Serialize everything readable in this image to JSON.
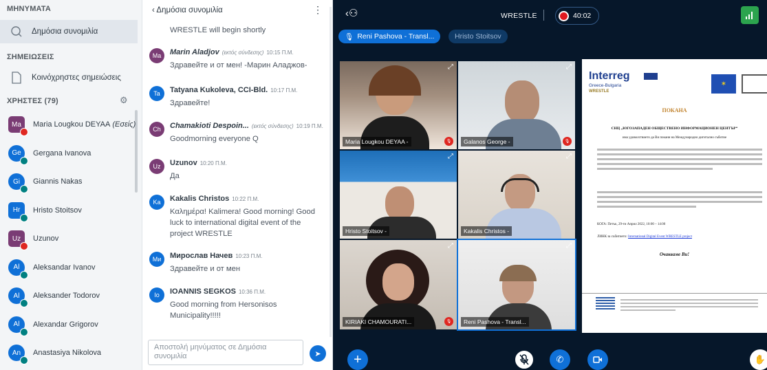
{
  "sidebar": {
    "messages_heading": "ΜΗΝΥΜΑΤΑ",
    "public_chat": "Δημόσια συνομιλία",
    "notes_heading": "ΣΗΜΕΙΩΣΕΙΣ",
    "shared_notes": "Κοινόχρηστες σημειώσεις",
    "users_heading": "ΧΡΗΣΤΕΣ (79)",
    "users": [
      {
        "initials": "Ma",
        "name": "Maria Lougkou DEYAA",
        "suffix": "(Εσείς)",
        "color": "#7a3c74",
        "mic": "off",
        "shape": "square"
      },
      {
        "initials": "Ge",
        "name": "Gergana Ivanova",
        "color": "#0f70d7",
        "mic": "on",
        "shape": "round"
      },
      {
        "initials": "Gi",
        "name": "Giannis Nakas",
        "color": "#0f70d7",
        "mic": "on",
        "shape": "round"
      },
      {
        "initials": "Hr",
        "name": "Hristo Stoitsov",
        "color": "#0f70d7",
        "mic": "on",
        "shape": "square"
      },
      {
        "initials": "Uz",
        "name": "Uzunov",
        "color": "#7a3c74",
        "mic": "off",
        "shape": "square"
      },
      {
        "initials": "Al",
        "name": "Aleksandar Ivanov",
        "color": "#0f70d7",
        "mic": "on",
        "shape": "round"
      },
      {
        "initials": "Al",
        "name": "Aleksander Todorov",
        "color": "#0f70d7",
        "mic": "on",
        "shape": "round"
      },
      {
        "initials": "Al",
        "name": "Alexandar Grigorov",
        "color": "#0f70d7",
        "mic": "on",
        "shape": "round"
      },
      {
        "initials": "An",
        "name": "Anastasiya Nikolova",
        "color": "#0f70d7",
        "mic": "on",
        "shape": "round"
      }
    ]
  },
  "chat": {
    "back_label": "Δημόσια συνομιλία",
    "kebab": "⋮",
    "welcome_tail": "WRESTLE will begin shortly",
    "messages": [
      {
        "initials": "Ma",
        "name": "Marin Aladjov",
        "status": "(εκτός σύνδεσης)",
        "time": "10:15 Π.Μ.",
        "text": "Здравейте и от мен! -Марин Аладжов-",
        "color": "#7a3c74"
      },
      {
        "initials": "Ta",
        "name": "Tatyana Kukoleva, CCI-Bld.",
        "time": "10:17 Π.Μ.",
        "text": "Здравейте!",
        "color": "#0f70d7"
      },
      {
        "initials": "Ch",
        "name": "Chamakioti Despoin...",
        "status": "(εκτός σύνδεσης)",
        "time": "10:19 Π.Μ.",
        "text": "Goodmorning everyone Q",
        "color": "#7a3c74"
      },
      {
        "initials": "Uz",
        "name": "Uzunov",
        "time": "10:20 Π.Μ.",
        "text": "Да",
        "color": "#7a3c74"
      },
      {
        "initials": "Ka",
        "name": "Kakalis Christos",
        "time": "10:22 Π.Μ.",
        "text": "Καλημέρα! Kalimera! Good morning! Good luck to international digital event of the project WRESTLE",
        "color": "#0f70d7"
      },
      {
        "initials": "Ми",
        "name": "Мирослав Начев",
        "time": "10:23 Π.Μ.",
        "text": "Здравейте и от мен",
        "color": "#0f70d7"
      },
      {
        "initials": "Io",
        "name": "IOANNIS SEGKOS",
        "time": "10:36 Π.Μ.",
        "text": "Good morning from Hersonisos Municipality!!!!!",
        "color": "#0f70d7"
      }
    ],
    "input_placeholder": "Αποστολή μηνύματος σε Δημόσια συνομιλία",
    "send_icon": "➤"
  },
  "meeting": {
    "title": "WRESTLE",
    "timer": "40:02",
    "talking": [
      "Reni Pashova - Transl...",
      "Hristo Stoitsov"
    ],
    "tiles": [
      {
        "name": "Maria Lougkou DEYAA -",
        "muted": true
      },
      {
        "name": "Galanos George -",
        "muted": true
      },
      {
        "name": "Hristo Stoitsov -",
        "muted": false
      },
      {
        "name": "Kakalis Christos -",
        "muted": false
      },
      {
        "name": "KIRIAKI CHAMOURATI...",
        "muted": true
      },
      {
        "name": "Reni Pashova - Transl...",
        "muted": false
      }
    ],
    "doc": {
      "brand": "Interreg",
      "brand_sub": "Greece-Bulgaria",
      "project": "WRESTLE",
      "heading": "ПОКАНА",
      "org": "СНЦ „ЮГОЗАПАДЕН ОБЩЕСТВЕНО ИНФОРМАЦИОНЕН ЦЕНТЪР“",
      "line1": "има удоволствието да Ви покани на Международно дигитално събитие",
      "when": "КОГА: Петък, 29-ти Април 2022, 10:00 – 14:00",
      "link_label": "ЛИНК за събитието:",
      "link": "International Digital Event WRESTLE project",
      "closing": "Очакваме Ви!"
    }
  }
}
